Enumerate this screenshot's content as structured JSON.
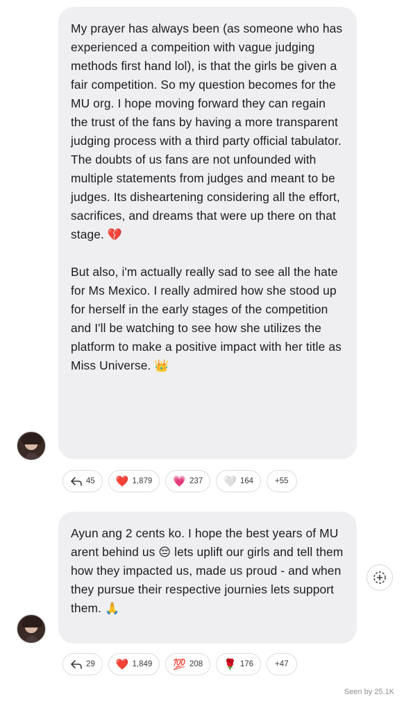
{
  "messages": [
    {
      "paragraphs": [
        "My prayer has always been (as someone who has experienced a compeition with vague judging methods first hand lol), is that the girls be given a fair competition. So my question becomes for the MU org. I hope moving forward they can regain the trust of the fans by having a more transparent judging process with a third party official tabulator. The doubts of us fans are not unfounded with multiple statements from judges and meant to be judges. Its disheartening considering all the effort, sacrifices, and dreams that were up there on that stage.",
        "But also, i'm actually really sad to see all the hate for Ms Mexico. I really admired how she stood up for herself in the early stages of the competition and I'll be watching to see how she utilizes the platform to make a positive impact with her title as Miss Universe."
      ],
      "emoji_end_1": "💔",
      "emoji_end_2": "👑",
      "reactions": {
        "reply_count": "45",
        "heart_emoji": "❤️",
        "heart_count": "1,879",
        "pink_heart_emoji": "💗",
        "pink_heart_count": "237",
        "white_heart_emoji": "🤍",
        "white_heart_count": "164",
        "more": "+55"
      }
    },
    {
      "text_part1": "Ayun ang 2 cents ko. I hope the best years of MU arent behind us",
      "emoji_mid": "😔",
      "text_part2": "lets uplift our girls and tell them how they impacted us, made us proud - and when they pursue their respective journies lets support them.",
      "emoji_end": "🙏",
      "reactions": {
        "reply_count": "29",
        "heart_emoji": "❤️",
        "heart_count": "1,849",
        "hundred_emoji": "💯",
        "hundred_count": "208",
        "rose_emoji": "🌹",
        "rose_count": "176",
        "more": "+47"
      }
    }
  ],
  "seen_by": "Seen by 25.1K"
}
